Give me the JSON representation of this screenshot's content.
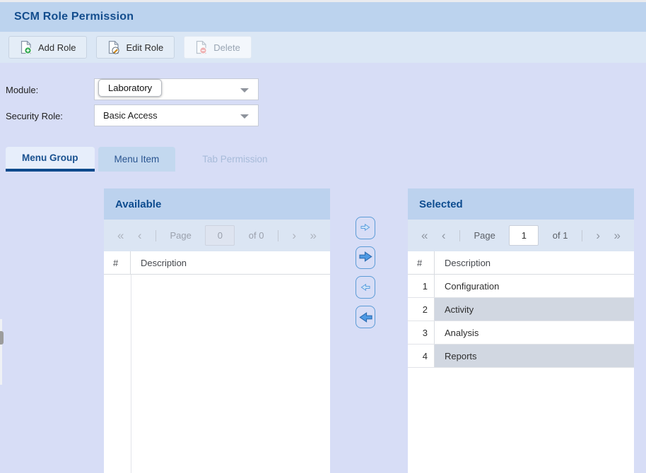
{
  "titlebar": {
    "title": "SCM Role Permission"
  },
  "toolbar": {
    "add_button": "Add Role",
    "edit_button": "Edit Role",
    "delete_button": "Delete"
  },
  "form": {
    "module_label": "Module:",
    "module_tooltip": "Laboratory",
    "security_label": "Security Role:",
    "security_value": "Basic Access"
  },
  "tabs": {
    "menu_group": "Menu Group",
    "menu_item": "Menu Item",
    "tab_permission": "Tab Permission"
  },
  "pager_icons": {
    "first": "«",
    "prev": "‹",
    "next": "›",
    "last": "»"
  },
  "available_panel": {
    "title": "Available",
    "pager": {
      "page_label": "Page",
      "page_value": "0",
      "of_text": "of 0"
    },
    "table": {
      "col_num": "#",
      "col_desc": "Description",
      "rows": []
    }
  },
  "selected_panel": {
    "title": "Selected",
    "pager": {
      "page_label": "Page",
      "page_value": "1",
      "of_text": "of 1"
    },
    "table": {
      "col_num": "#",
      "col_desc": "Description",
      "rows": [
        {
          "num": "1",
          "desc": "Configuration"
        },
        {
          "num": "2",
          "desc": "Activity"
        },
        {
          "num": "3",
          "desc": "Analysis"
        },
        {
          "num": "4",
          "desc": "Reports"
        }
      ]
    }
  },
  "colors": {
    "accent_blue": "#134d8d",
    "header_bar": "#bcd3ee",
    "toolbar_bg": "#dbe7f5",
    "page_bg": "#d7ddf6",
    "panel_header_bg": "#bcd2ee",
    "pager_bg": "#dbe5f3",
    "stripe_row": "#d1d7e1",
    "tab_underline": "#0d4a8c",
    "arrow_fill": "#4f9ae4"
  }
}
